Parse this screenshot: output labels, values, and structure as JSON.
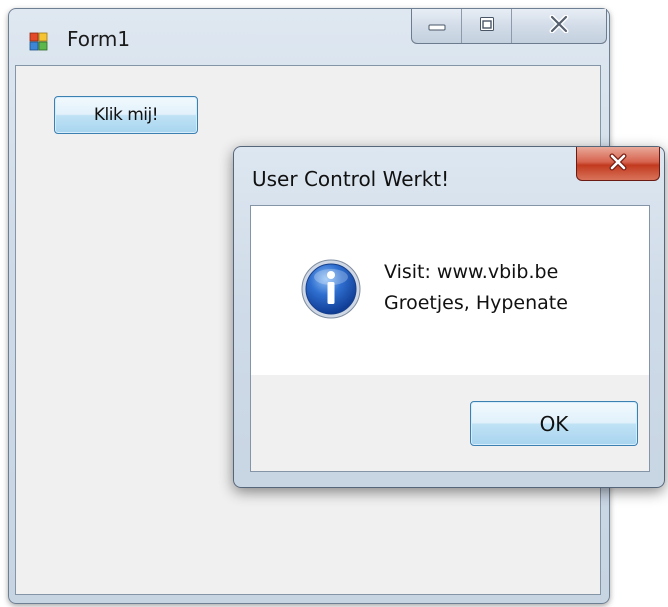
{
  "main_window": {
    "title": "Form1",
    "icon": "form-app-icon",
    "caption_buttons": {
      "minimize_icon": "minimize-icon",
      "maximize_icon": "maximize-icon",
      "close_icon": "close-icon"
    },
    "button_label": "Klik mij!"
  },
  "message_box": {
    "title": "User Control Werkt!",
    "close_icon": "close-icon",
    "icon": "info-icon",
    "lines": [
      "Visit: www.vbib.be",
      "Groetjes, Hypenate"
    ],
    "ok_label": "OK"
  },
  "colors": {
    "button_border": "#3c7fb1",
    "close_red": "#c23a1f",
    "client_bg": "#f0f0f0"
  }
}
